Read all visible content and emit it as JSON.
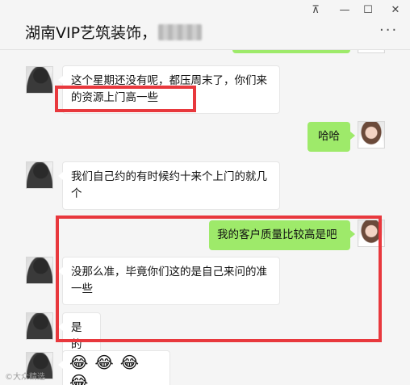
{
  "window": {
    "title": "湖南VIP艺筑装饰，",
    "pin_icon": "pin-icon",
    "minimize_label": "—",
    "maximize_label": "☐",
    "close_label": "✕",
    "more_label": "···"
  },
  "messages": [
    {
      "side": "left",
      "text": "这个星期还没有呢，都压周末了，你们来的资源上门高一些"
    },
    {
      "side": "right",
      "text": "哈哈"
    },
    {
      "side": "left",
      "text": "我们自己约的有时候约十来个上门的就几个"
    },
    {
      "side": "right",
      "text": "我的客户质量比较高是吧"
    },
    {
      "side": "left",
      "text": "没那么准，毕竟你们这的是自己来问的准一些"
    },
    {
      "side": "left",
      "text": "是的"
    },
    {
      "side": "left",
      "emojis": [
        "😂",
        "😂",
        "😂",
        "😂"
      ]
    }
  ],
  "watermark": "©大众精选",
  "colors": {
    "self_bubble": "#9eea6a",
    "highlight": "#e8383d",
    "background": "#f5f5f5"
  }
}
